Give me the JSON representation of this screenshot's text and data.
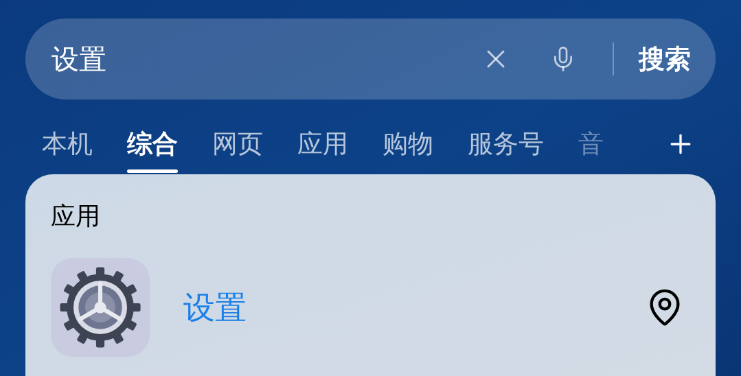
{
  "search": {
    "value": "设置",
    "button": "搜索"
  },
  "tabs": [
    {
      "label": "本机",
      "selected": false
    },
    {
      "label": "综合",
      "selected": true
    },
    {
      "label": "网页",
      "selected": false
    },
    {
      "label": "应用",
      "selected": false
    },
    {
      "label": "购物",
      "selected": false
    },
    {
      "label": "服务号",
      "selected": false
    },
    {
      "label": "音",
      "selected": false
    }
  ],
  "card": {
    "title": "应用",
    "results": [
      {
        "name": "设置"
      }
    ]
  }
}
